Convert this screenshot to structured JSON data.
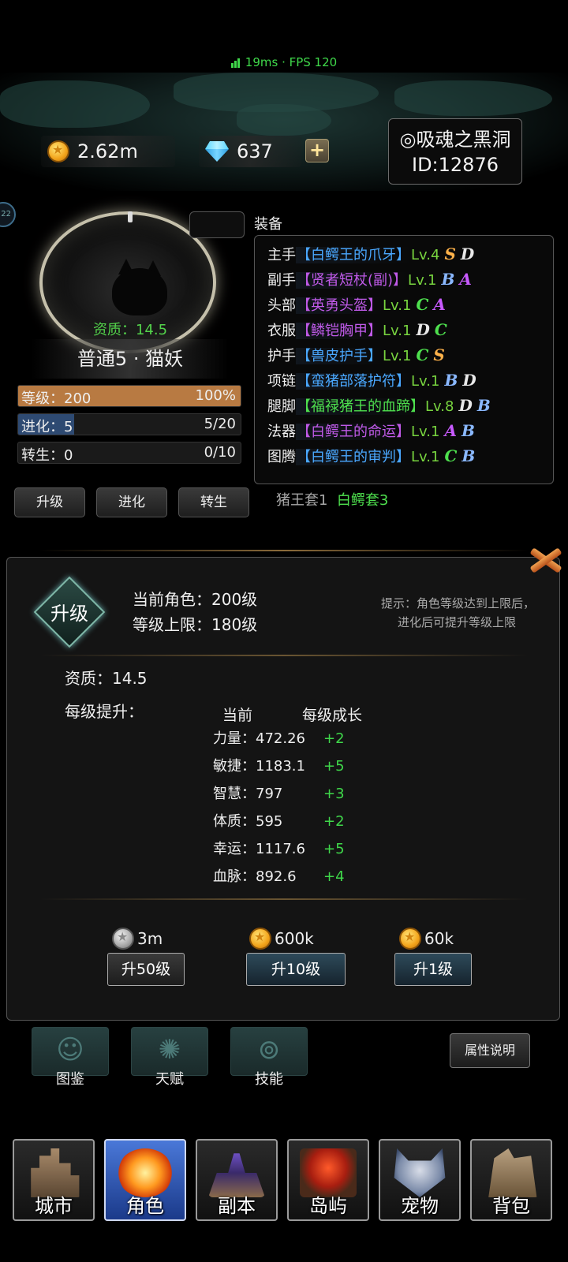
{
  "status": {
    "text": "19ms · FPS 120"
  },
  "currency": {
    "gold": "2.62m",
    "diamond": "637"
  },
  "profile": {
    "name": "◎吸魂之黑洞",
    "id": "ID:12876"
  },
  "side_badge": "22",
  "character": {
    "aptitude": "资质：14.5",
    "name": "普通5 · 猫妖",
    "bars": [
      {
        "label": "等级：200",
        "value": "100%",
        "fraction": 1.0,
        "color": "#b87a42"
      },
      {
        "label": "进化：5",
        "value": "5/20",
        "fraction": 0.25,
        "color": "#2e4a72"
      },
      {
        "label": "转生：0",
        "value": "0/10",
        "fraction": 0.0,
        "color": "#444444"
      }
    ],
    "actions": [
      "升级",
      "进化",
      "转生"
    ]
  },
  "equipment": {
    "title": "装备",
    "rows": [
      {
        "slot": "主手",
        "item": "【白鳄王的爪牙】",
        "item_color": "#4aa8ff",
        "lv": "Lv.4",
        "g1": "S",
        "c1": "#ffb24a",
        "g2": "D",
        "c2": "#e8e8e8"
      },
      {
        "slot": "副手",
        "item": "【贤者短杖(副)】",
        "item_color": "#c05ae8",
        "lv": "Lv.1",
        "g1": "B",
        "c1": "#8ab8ff",
        "g2": "A",
        "c2": "#c85aff"
      },
      {
        "slot": "头部",
        "item": "【英勇头盔】",
        "item_color": "#c05ae8",
        "lv": "Lv.1",
        "g1": "C",
        "c1": "#4ee04e",
        "g2": "A",
        "c2": "#c85aff"
      },
      {
        "slot": "衣服",
        "item": "【鳞铠胸甲】",
        "item_color": "#c05ae8",
        "lv": "Lv.1",
        "g1": "D",
        "c1": "#e8e8e8",
        "g2": "C",
        "c2": "#4ee04e"
      },
      {
        "slot": "护手",
        "item": "【兽皮护手】",
        "item_color": "#4aa8ff",
        "lv": "Lv.1",
        "g1": "C",
        "c1": "#4ee04e",
        "g2": "S",
        "c2": "#ffb24a"
      },
      {
        "slot": "项链",
        "item": "【蛮猪部落护符】",
        "item_color": "#4aa8ff",
        "lv": "Lv.1",
        "g1": "B",
        "c1": "#8ab8ff",
        "g2": "D",
        "c2": "#e8e8e8"
      },
      {
        "slot": "腿脚",
        "item": "【福禄猪王的血蹄】",
        "item_color": "#4ee04e",
        "lv": "Lv.8",
        "g1": "D",
        "c1": "#e8e8e8",
        "g2": "B",
        "c2": "#8ab8ff"
      },
      {
        "slot": "法器",
        "item": "【白鳄王的命运】",
        "item_color": "#c05ae8",
        "lv": "Lv.1",
        "g1": "A",
        "c1": "#c85aff",
        "g2": "B",
        "c2": "#8ab8ff"
      },
      {
        "slot": "图腾",
        "item": "【白鳄王的审判】",
        "item_color": "#4aa8ff",
        "lv": "Lv.1",
        "g1": "C",
        "c1": "#4ee04e",
        "g2": "B",
        "c2": "#8ab8ff"
      }
    ],
    "sets": [
      {
        "text": "猪王套1",
        "color": "#a8a8a8"
      },
      {
        "text": "白鳄套3",
        "color": "#4ee04e"
      }
    ]
  },
  "detail": {
    "badge": "升级",
    "current_role_label": "当前角色：",
    "current_role_value": "200级",
    "level_cap_label": "等级上限：",
    "level_cap_value": "180级",
    "hint_line1": "提示：角色等级达到上限后，",
    "hint_line2": "进化后可提升等级上限",
    "aptitude": "资质：14.5",
    "per_level": "每级提升：",
    "col_current": "当前",
    "col_growth": "每级成长",
    "attrs": [
      {
        "name": "力量：472.26",
        "inc": "+2"
      },
      {
        "name": "敏捷：1183.1",
        "inc": "+5"
      },
      {
        "name": "智慧：797",
        "inc": "+3"
      },
      {
        "name": "体质：595",
        "inc": "+2"
      },
      {
        "name": "幸运：1117.6",
        "inc": "+5"
      },
      {
        "name": "血脉：892.6",
        "inc": "+4"
      }
    ],
    "upgrades": [
      {
        "cost": "3m",
        "currency": "silver",
        "label": "升50级"
      },
      {
        "cost": "600k",
        "currency": "gold",
        "label": "升10级"
      },
      {
        "cost": "60k",
        "currency": "gold",
        "label": "升1级"
      }
    ]
  },
  "functions": [
    {
      "label": "图鉴",
      "icon": "alien-face-icon"
    },
    {
      "label": "天赋",
      "icon": "swirl-figure-icon"
    },
    {
      "label": "技能",
      "icon": "spiral-icon"
    }
  ],
  "attr_explain": "属性说明",
  "nav": [
    {
      "label": "城市",
      "icon": "castle-icon",
      "active": false
    },
    {
      "label": "角色",
      "icon": "fire-orb-icon",
      "active": true
    },
    {
      "label": "副本",
      "icon": "dungeon-tower-icon",
      "active": false
    },
    {
      "label": "岛屿",
      "icon": "volcano-island-icon",
      "active": false
    },
    {
      "label": "宠物",
      "icon": "wolf-pet-icon",
      "active": false
    },
    {
      "label": "背包",
      "icon": "bag-icon",
      "active": false
    }
  ]
}
